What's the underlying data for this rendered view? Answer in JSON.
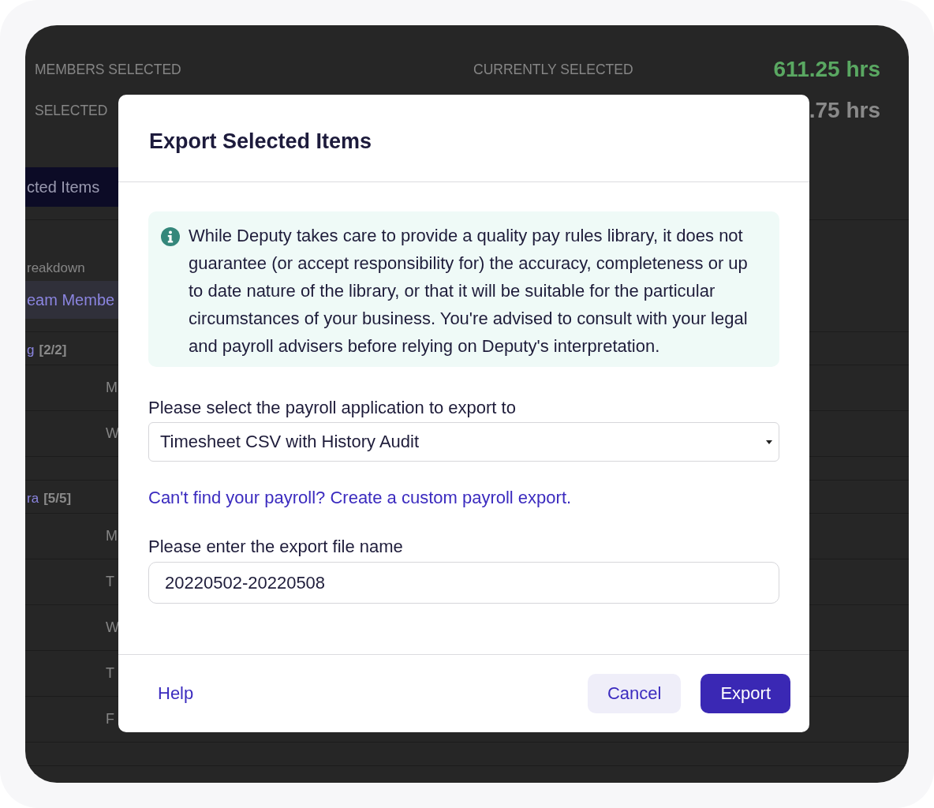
{
  "background": {
    "summary": [
      {
        "label": "MEMBERS SELECTED",
        "detail_label": "CURRENTLY SELECTED",
        "value": "611.25 hrs",
        "highlight": true
      },
      {
        "label": "SELECTED",
        "value": ".75 hrs",
        "highlight": false
      }
    ],
    "action_button": "cted Items",
    "section_heading": "reakdown",
    "tabs": [
      {
        "label": "eam Membe",
        "selected": true
      }
    ],
    "groups": [
      {
        "name": "g",
        "count": "[2/2]",
        "days": [
          "M",
          "W"
        ]
      },
      {
        "name": "ra",
        "count": "[5/5]",
        "days": [
          "M",
          "T",
          "W",
          "T",
          "F"
        ]
      }
    ]
  },
  "dialog": {
    "title": "Export Selected Items",
    "notice": "While Deputy takes care to provide a quality pay rules library, it does not guarantee (or accept responsibility for) the accuracy, completeness or up to date nature of the library, or that it will be suitable for the particular circumstances of your business. You're advised to consult with your legal and payroll advisers before relying on Deputy's interpretation.",
    "payroll_select": {
      "label": "Please select the payroll application to export to",
      "value": "Timesheet CSV with History Audit"
    },
    "custom_export_link": "Can't find your payroll? Create a custom payroll export.",
    "file_name_field": {
      "label": "Please enter the export file name",
      "value": "20220502-20220508"
    },
    "footer": {
      "help_link": "Help",
      "buttons": [
        {
          "label": "Cancel",
          "kind": "secondary"
        },
        {
          "label": "Export",
          "kind": "primary"
        }
      ]
    }
  }
}
